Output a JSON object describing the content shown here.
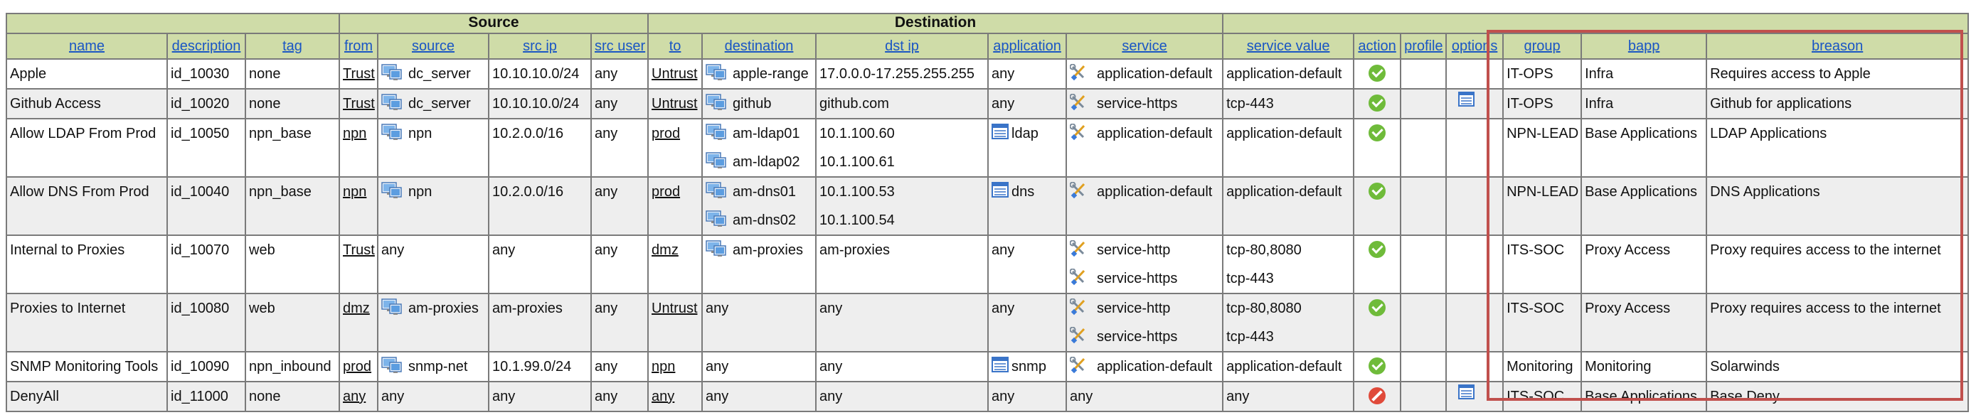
{
  "colors": {
    "header_bg": "#cfdca8",
    "link": "#1a56c4",
    "highlight": "#c0504d",
    "allow": "#6fbb3a",
    "deny": "#e04a3a"
  },
  "groups": {
    "source": "Source",
    "destination": "Destination"
  },
  "columns": [
    "name",
    "description",
    "tag",
    "from",
    "source",
    "src ip",
    "src user",
    "to",
    "destination",
    "dst ip",
    "application",
    "service",
    "service value",
    "action",
    "profile",
    "options",
    "group",
    "bapp",
    "breason"
  ],
  "rows": [
    {
      "name": "Apple",
      "description": "id_10030",
      "tag": "none",
      "from": "Trust",
      "source": [
        "dc_server"
      ],
      "src_ip": [
        "10.10.10.0/24"
      ],
      "src_user": "any",
      "to": "Untrust",
      "destination": [
        "apple-range"
      ],
      "dst_ip": [
        "17.0.0.0-17.255.255.255"
      ],
      "application": "any",
      "service": [
        "application-default"
      ],
      "service_value": [
        "application-default"
      ],
      "action": "allow",
      "profile": "",
      "options": false,
      "group": "IT-OPS",
      "bapp": "Infra",
      "breason": "Requires access to Apple"
    },
    {
      "name": "Github Access",
      "description": "id_10020",
      "tag": "none",
      "from": "Trust",
      "source": [
        "dc_server"
      ],
      "src_ip": [
        "10.10.10.0/24"
      ],
      "src_user": "any",
      "to": "Untrust",
      "destination": [
        "github"
      ],
      "dst_ip": [
        "github.com"
      ],
      "application": "any",
      "service": [
        "service-https"
      ],
      "service_value": [
        "tcp-443"
      ],
      "action": "allow",
      "profile": "",
      "options": true,
      "group": "IT-OPS",
      "bapp": "Infra",
      "breason": "Github for applications"
    },
    {
      "name": "Allow LDAP From Prod",
      "description": "id_10050",
      "tag": "npn_base",
      "from": "npn",
      "source": [
        "npn"
      ],
      "src_ip": [
        "10.2.0.0/16"
      ],
      "src_user": "any",
      "to": "prod",
      "destination": [
        "am-ldap01",
        "am-ldap02"
      ],
      "dst_ip": [
        "10.1.100.60",
        "10.1.100.61"
      ],
      "application": "ldap",
      "service": [
        "application-default"
      ],
      "service_value": [
        "application-default"
      ],
      "action": "allow",
      "profile": "",
      "options": false,
      "group": "NPN-LEAD",
      "bapp": "Base Applications",
      "breason": "LDAP Applications"
    },
    {
      "name": "Allow DNS From Prod",
      "description": "id_10040",
      "tag": "npn_base",
      "from": "npn",
      "source": [
        "npn"
      ],
      "src_ip": [
        "10.2.0.0/16"
      ],
      "src_user": "any",
      "to": "prod",
      "destination": [
        "am-dns01",
        "am-dns02"
      ],
      "dst_ip": [
        "10.1.100.53",
        "10.1.100.54"
      ],
      "application": "dns",
      "service": [
        "application-default"
      ],
      "service_value": [
        "application-default"
      ],
      "action": "allow",
      "profile": "",
      "options": false,
      "group": "NPN-LEAD",
      "bapp": "Base Applications",
      "breason": "DNS Applications"
    },
    {
      "name": "Internal to Proxies",
      "description": "id_10070",
      "tag": "web",
      "from": "Trust",
      "source": [
        "any"
      ],
      "src_ip": [
        "any"
      ],
      "src_user": "any",
      "to": "dmz",
      "destination": [
        "am-proxies"
      ],
      "dst_ip": [
        "am-proxies"
      ],
      "application": "any",
      "service": [
        "service-http",
        "service-https"
      ],
      "service_value": [
        "tcp-80,8080",
        "tcp-443"
      ],
      "action": "allow",
      "profile": "",
      "options": false,
      "group": "ITS-SOC",
      "bapp": "Proxy Access",
      "breason": "Proxy requires access to the internet"
    },
    {
      "name": "Proxies to Internet",
      "description": "id_10080",
      "tag": "web",
      "from": "dmz",
      "source": [
        "am-proxies"
      ],
      "src_ip": [
        "am-proxies"
      ],
      "src_user": "any",
      "to": "Untrust",
      "destination": [
        "any"
      ],
      "dst_ip": [
        "any"
      ],
      "application": "any",
      "service": [
        "service-http",
        "service-https"
      ],
      "service_value": [
        "tcp-80,8080",
        "tcp-443"
      ],
      "action": "allow",
      "profile": "",
      "options": false,
      "group": "ITS-SOC",
      "bapp": "Proxy Access",
      "breason": "Proxy requires access to the internet"
    },
    {
      "name": "SNMP Monitoring Tools",
      "description": "id_10090",
      "tag": "npn_inbound",
      "from": "prod",
      "source": [
        "snmp-net"
      ],
      "src_ip": [
        "10.1.99.0/24"
      ],
      "src_user": "any",
      "to": "npn",
      "destination": [
        "any"
      ],
      "dst_ip": [
        "any"
      ],
      "application": "snmp",
      "service": [
        "application-default"
      ],
      "service_value": [
        "application-default"
      ],
      "action": "allow",
      "profile": "",
      "options": false,
      "group": "Monitoring",
      "bapp": "Monitoring",
      "breason": "Solarwinds"
    },
    {
      "name": "DenyAll",
      "description": "id_11000",
      "tag": "none",
      "from": "any",
      "source": [
        "any"
      ],
      "src_ip": [
        "any"
      ],
      "src_user": "any",
      "to": "any",
      "destination": [
        "any"
      ],
      "dst_ip": [
        "any"
      ],
      "application": "any",
      "service": [
        "any"
      ],
      "service_value": [
        "any"
      ],
      "action": "deny",
      "profile": "",
      "options": true,
      "group": "ITS-SOC",
      "bapp": "Base Applications",
      "breason": "Base Deny"
    }
  ]
}
